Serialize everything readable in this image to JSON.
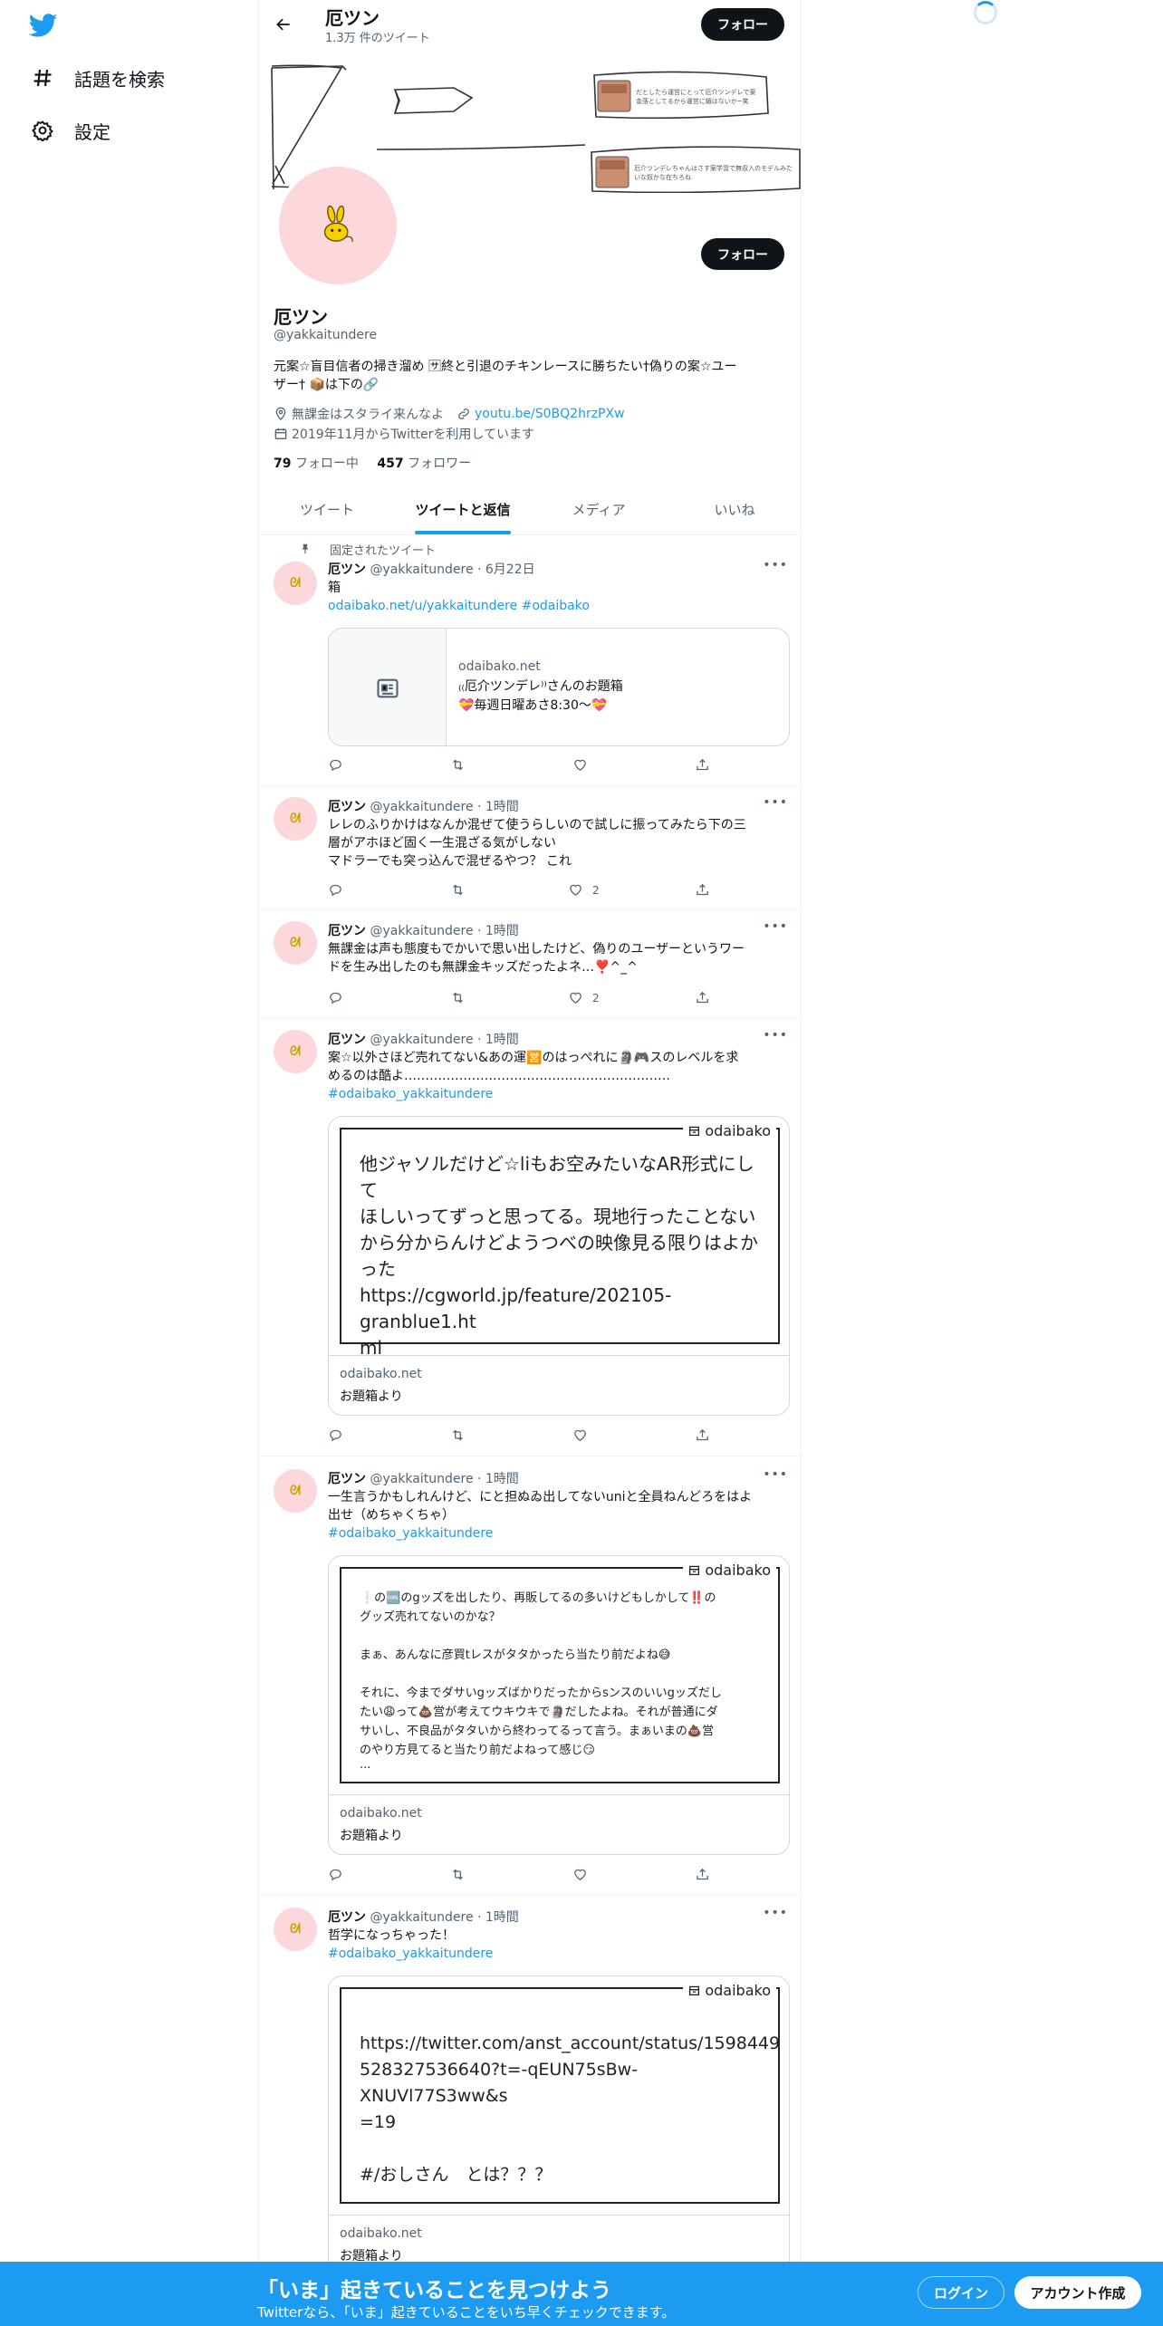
{
  "nav": {
    "explore_label": "話題を検索",
    "settings_label": "設定"
  },
  "header": {
    "name": "厄ツン",
    "tweet_count": "1.3万 件のツイート",
    "follow_label": "フォロー"
  },
  "profile": {
    "name": "厄ツン",
    "handle": "@yakkaitundere",
    "bio_line1": "元案☆盲目信者の掃き溜め 🈂終と引退のチキンレースに勝ちたい†偽りの案☆ユー",
    "bio_line2": "ザー† 📦は下の🔗",
    "location": "無課金はスタライ来んなよ",
    "website": "youtu.be/S0BQ2hrzPXw",
    "joined": "2019年11月からTwitterを利用しています",
    "following_count": "79",
    "following_label": "フォロー中",
    "followers_count": "457",
    "followers_label": "フォロワー",
    "follow_label": "フォロー"
  },
  "banner": {
    "note1": "だとしたら運営にとって厄介ツンデレで案 金落としてるから運営に媚はないか~笑",
    "note2": "厄介ツンデレちゃんはさす案学習で無収入のモデルみたいな奴かな在ちろね"
  },
  "tabs": [
    {
      "label": "ツイート"
    },
    {
      "label": "ツイートと返信"
    },
    {
      "label": "メディア"
    },
    {
      "label": "いいね"
    }
  ],
  "pinned_label": "固定されたツイート",
  "tweets": [
    {
      "name": "厄ツン",
      "meta": "@yakkaitundere · 6月22日",
      "text1": "箱",
      "link": "odaibako.net/u/yakkaitundere",
      "hashtag": "#odaibako",
      "card_domain": "odaibako.net",
      "card_title": "₍₍厄介ツンデレ⁾⁾さんのお題箱",
      "card_desc": "💝毎週日曜あさ8:30〜💝"
    },
    {
      "name": "厄ツン",
      "meta": "@yakkaitundere · 1時間",
      "line1": "レレのふりかけはなんか混ぜて使うらしいので試しに振ってみたら下の三",
      "line2": "層がアホほど固く一生混ざる気がしない",
      "line3": "マドラーでも突っ込んで混ぜるやつ？ これ",
      "likes": "2"
    },
    {
      "name": "厄ツン",
      "meta": "@yakkaitundere · 1時間",
      "line1": "無課金は声も態度もでかいで思い出したけど、偽りのユーザーというワー",
      "line2": "ドを生み出したのも無課金キッズだったよネ…❣️^_^",
      "likes": "2"
    },
    {
      "name": "厄ツン",
      "meta": "@yakkaitundere · 1時間",
      "line1": "案☆以外さほど売れてない&あの運🈺のはっぺれに🗿🎮スのレベルを求",
      "line2": "めるのは酷よ………………………………………………………",
      "hashtag": "#odaibako_yakkaitundere",
      "brand": "odaibako",
      "body": [
        "他ジャソルだけど☆liもお空みたいなAR形式にして",
        "ほしいってずっと思ってる。現地行ったことない",
        "から分からんけどようつべの映像見る限りはよか",
        "った",
        "https://cgworld.jp/feature/202105-granblue1.ht",
        "ml"
      ],
      "card_domain": "odaibako.net",
      "card_title": "お題箱より"
    },
    {
      "name": "厄ツン",
      "meta": "@yakkaitundere · 1時間",
      "line1": "一生言うかもしれんけど、にと担ぬゐ出してないuniと全員ねんどろをはよ",
      "line2": "出せ（めちゃくちゃ）",
      "hashtag": "#odaibako_yakkaitundere",
      "brand": "odaibako",
      "body": [
        "❕の🆒のgッズを出したり、再販してるの多いけどもしかして‼️の",
        "グッズ売れてないのかな？",
        "",
        "まぁ、あんなに彦買tレスがタタかったら当たり前だよね😅",
        "",
        "それに、今までダサいgッズばかりだったからsンスのいいgッズだし",
        "たい😩って💩営が考えてウキウキで🗿だしたよね。それが普通にダ",
        "サいし、不良品がタタいから終わってるって言う。まぁいまの💩営",
        "のやり方見てると当たり前だよねって感じ😏",
        "..."
      ],
      "card_domain": "odaibako.net",
      "card_title": "お題箱より"
    },
    {
      "name": "厄ツン",
      "meta": "@yakkaitundere · 1時間",
      "line1": "哲学になっちゃった！",
      "hashtag": "#odaibako_yakkaitundere",
      "brand": "odaibako",
      "body": [
        "https://twitter.com/anst_account/status/1598449",
        "528327536640?t=-qEUN75sBw-XNUVl77S3ww&s",
        "=19",
        "",
        "#/おしさん　とは？？？"
      ],
      "card_domain": "odaibako.net",
      "card_title": "お題箱より"
    }
  ],
  "bottom": {
    "title": "「いま」起きていることを見つけよう",
    "subtitle": "Twitterなら、「いま」起きていることをいち早くチェックできます。",
    "login": "ログイン",
    "signup": "アカウント作成"
  }
}
